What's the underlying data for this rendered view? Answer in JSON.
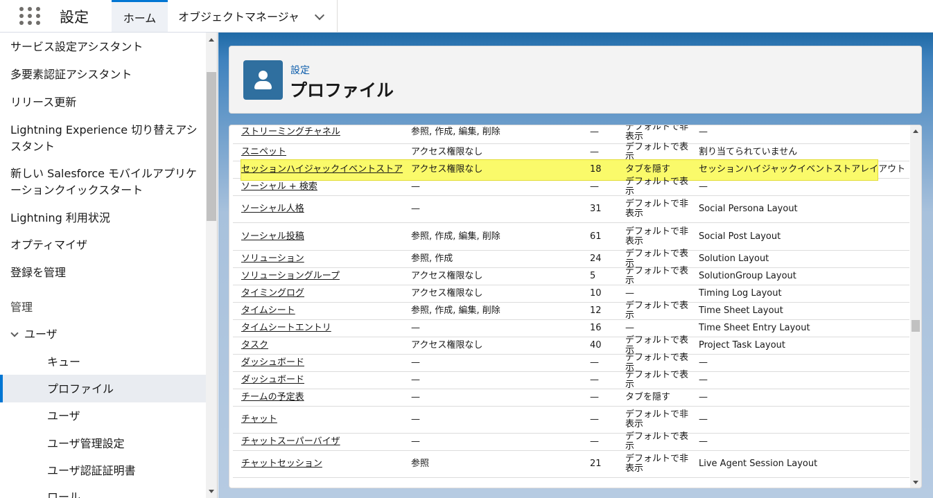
{
  "topbar": {
    "app_name": "設定",
    "tabs": [
      {
        "label": "ホーム",
        "active": true
      },
      {
        "label": "オブジェクトマネージャ",
        "has_dropdown": true
      }
    ],
    "icons": {
      "launcher": "app-launcher-grid-icon",
      "dropdown": "chevron-down-icon"
    }
  },
  "sidebar": {
    "items": [
      "サービス設定アシスタント",
      "多要素認証アシスタント",
      "リリース更新",
      "Lightning Experience 切り替えアシスタント",
      "新しい Salesforce モバイルアプリケーションクイックスタート",
      "Lightning 利用状況",
      "オプティマイザ",
      "登録を管理"
    ],
    "section": "管理",
    "users_group": "ユーザ",
    "sub_items": [
      "キュー",
      "プロファイル",
      "ユーザ",
      "ユーザ管理設定",
      "ユーザ認証証明書",
      "ロール"
    ],
    "active_item": "プロファイル"
  },
  "header": {
    "breadcrumb": "設定",
    "title": "プロファイル",
    "icon": "user-profile-icon"
  },
  "table": {
    "rows": [
      {
        "name": "ストリーミングチャネル",
        "perm": "参照, 作成, 編集, 削除",
        "num": "—",
        "vis": "デフォルトで非表示",
        "layout": "—"
      },
      {
        "name": "スニペット",
        "perm": "アクセス権限なし",
        "num": "—",
        "vis": "デフォルトで表示",
        "layout": "割り当てられていません"
      },
      {
        "name": "セッションハイジャックイベントストア",
        "perm": "アクセス権限なし",
        "num": "18",
        "vis": "タブを隠す",
        "layout": "セッションハイジャックイベントストアレイアウト",
        "highlight": true
      },
      {
        "name": "ソーシャル + 検索",
        "perm": "—",
        "num": "—",
        "vis": "デフォルトで表示",
        "layout": "—"
      },
      {
        "name": "ソーシャル人格",
        "perm": "—",
        "num": "31",
        "vis": "デフォルトで非表示",
        "layout": "Social Persona Layout"
      },
      {
        "name": "ソーシャル投稿",
        "perm": "参照, 作成, 編集, 削除",
        "num": "61",
        "vis": "デフォルトで非表示",
        "layout": "Social Post Layout"
      },
      {
        "name": "ソリューション",
        "perm": "参照, 作成",
        "num": "24",
        "vis": "デフォルトで表示",
        "layout": "Solution Layout"
      },
      {
        "name": "ソリューショングループ",
        "perm": "アクセス権限なし",
        "num": "5",
        "vis": "デフォルトで表示",
        "layout": "SolutionGroup Layout"
      },
      {
        "name": "タイミングログ",
        "perm": "アクセス権限なし",
        "num": "10",
        "vis": "—",
        "layout": "Timing Log Layout"
      },
      {
        "name": "タイムシート",
        "perm": "参照, 作成, 編集, 削除",
        "num": "12",
        "vis": "デフォルトで表示",
        "layout": "Time Sheet Layout"
      },
      {
        "name": "タイムシートエントリ",
        "perm": "—",
        "num": "16",
        "vis": "—",
        "layout": "Time Sheet Entry Layout"
      },
      {
        "name": "タスク",
        "perm": "アクセス権限なし",
        "num": "40",
        "vis": "デフォルトで表示",
        "layout": "Project Task Layout"
      },
      {
        "name": "ダッシュボード",
        "perm": "—",
        "num": "—",
        "vis": "デフォルトで表示",
        "layout": "—"
      },
      {
        "name": "ダッシュボード",
        "perm": "—",
        "num": "—",
        "vis": "デフォルトで表示",
        "layout": "—"
      },
      {
        "name": "チームの予定表",
        "perm": "—",
        "num": "—",
        "vis": "タブを隠す",
        "layout": "—"
      },
      {
        "name": "チャット",
        "perm": "—",
        "num": "—",
        "vis": "デフォルトで非表示",
        "layout": "—"
      },
      {
        "name": "チャットスーパーバイザ",
        "perm": "—",
        "num": "—",
        "vis": "デフォルトで表示",
        "layout": "—"
      },
      {
        "name": "チャットセッション",
        "perm": "参照",
        "num": "21",
        "vis": "デフォルトで非表示",
        "layout": "Live Agent Session Layout"
      }
    ]
  }
}
